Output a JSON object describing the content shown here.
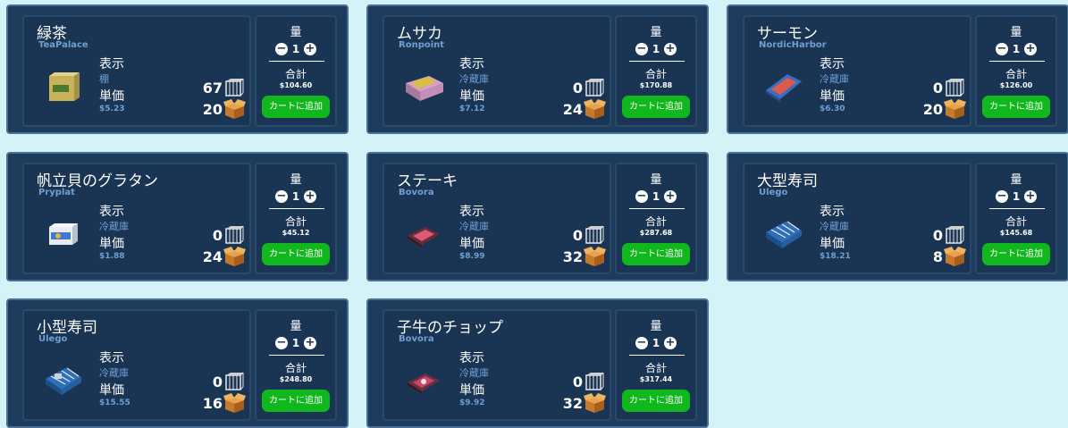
{
  "labels": {
    "display": "表示",
    "unit_price": "単価",
    "quantity": "量",
    "total": "合計",
    "add_to_cart": "カートに追加"
  },
  "products": [
    {
      "name": "緑茶",
      "brand": "TeaPalace",
      "location": "棚",
      "unit_price": "$5.23",
      "stock": "67",
      "per_case": "20",
      "qty": "1",
      "total": "$104.60",
      "image": "green-tea-box"
    },
    {
      "name": "ムサカ",
      "brand": "Ronpoint",
      "location": "冷蔵庫",
      "unit_price": "$7.12",
      "stock": "0",
      "per_case": "24",
      "qty": "1",
      "total": "$170.88",
      "image": "moussaka-tray"
    },
    {
      "name": "サーモン",
      "brand": "NordicHarbor",
      "location": "冷蔵庫",
      "unit_price": "$6.30",
      "stock": "0",
      "per_case": "20",
      "qty": "1",
      "total": "$126.00",
      "image": "salmon-pack"
    },
    {
      "name": "帆立貝のグラタン",
      "brand": "Pryplat",
      "location": "冷蔵庫",
      "unit_price": "$1.88",
      "stock": "0",
      "per_case": "24",
      "qty": "1",
      "total": "$45.12",
      "image": "scallop-gratin-box"
    },
    {
      "name": "ステーキ",
      "brand": "Bovora",
      "location": "冷蔵庫",
      "unit_price": "$8.99",
      "stock": "0",
      "per_case": "32",
      "qty": "1",
      "total": "$287.68",
      "image": "steak-pack"
    },
    {
      "name": "大型寿司",
      "brand": "Ulego",
      "location": "冷蔵庫",
      "unit_price": "$18.21",
      "stock": "0",
      "per_case": "8",
      "qty": "1",
      "total": "$145.68",
      "image": "large-sushi-tray"
    },
    {
      "name": "小型寿司",
      "brand": "Ulego",
      "location": "冷蔵庫",
      "unit_price": "$15.55",
      "stock": "0",
      "per_case": "16",
      "qty": "1",
      "total": "$248.80",
      "image": "small-sushi-tray"
    },
    {
      "name": "子牛のチョップ",
      "brand": "Bovora",
      "location": "冷蔵庫",
      "unit_price": "$9.92",
      "stock": "0",
      "per_case": "32",
      "qty": "1",
      "total": "$317.44",
      "image": "veal-chop-pack"
    }
  ],
  "colors": {
    "background": "#d3f3f8",
    "card": "#1d3c5c",
    "panel": "#1a3554",
    "accent_text": "#6f9fd4",
    "add_button": "#11b81d"
  }
}
